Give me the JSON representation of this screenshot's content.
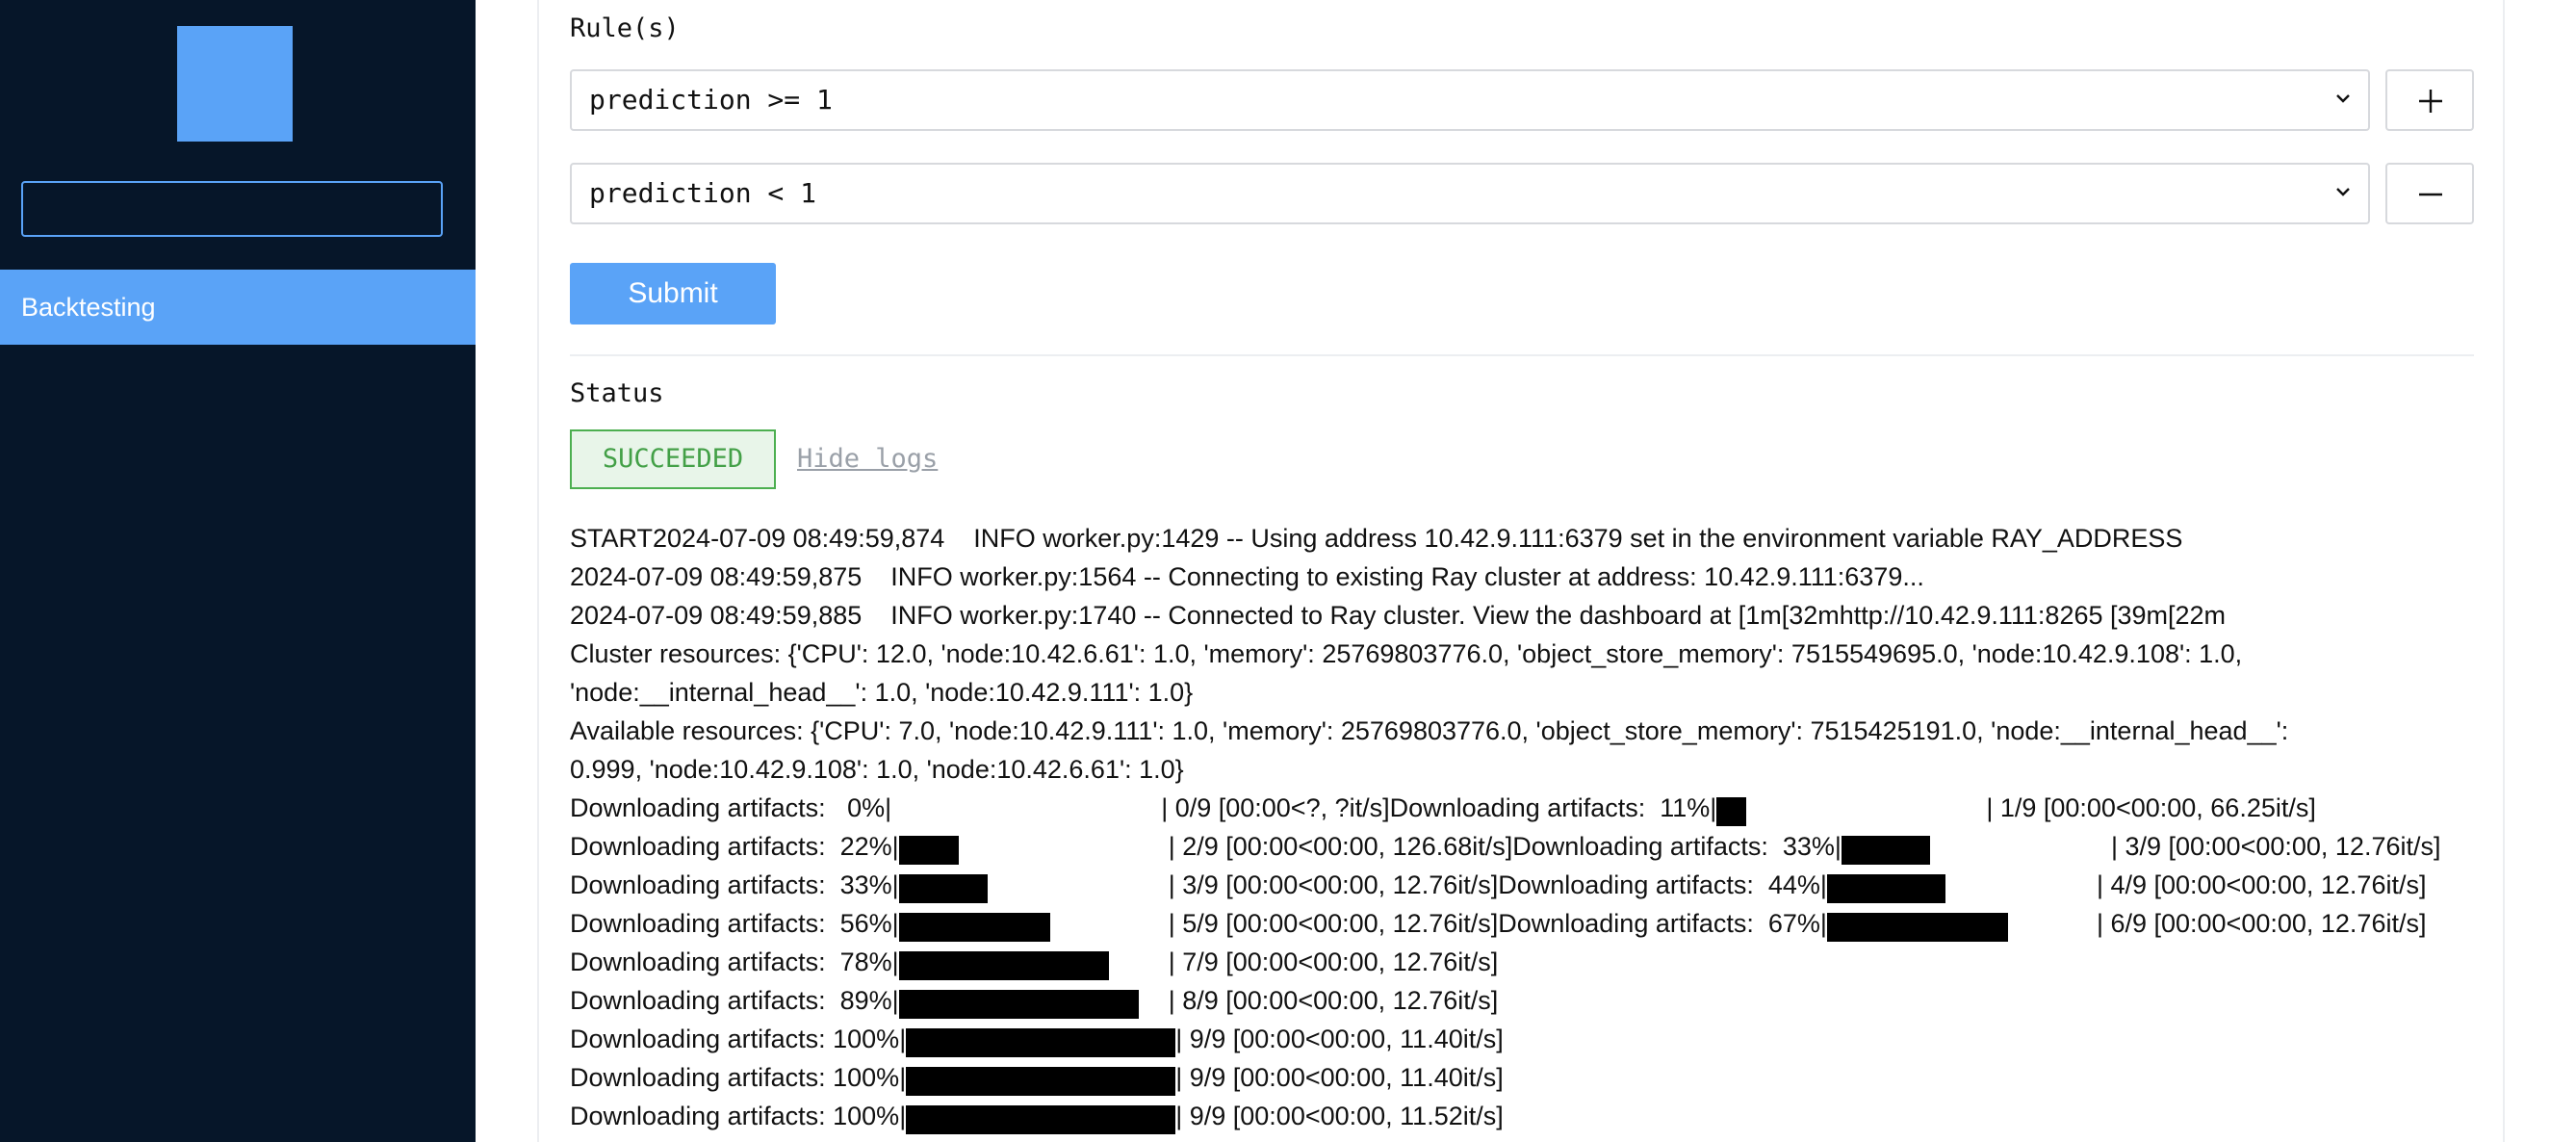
{
  "sidebar": {
    "search_value": "",
    "nav_items": [
      "Backtesting"
    ],
    "accent_color": "#5aa3f7",
    "background_color": "#061629"
  },
  "rules": {
    "label": "Rule(s)",
    "items": [
      {
        "value": "prediction >= 1",
        "action_icon": "plus-icon"
      },
      {
        "value": "prediction < 1",
        "action_icon": "minus-icon"
      }
    ]
  },
  "submit_label": "Submit",
  "status": {
    "label": "Status",
    "value": "SUCCEEDED",
    "hide_logs_label": "Hide logs"
  },
  "logs": {
    "lines": [
      "START2024-07-09 08:49:59,874    INFO worker.py:1429 -- Using address 10.42.9.111:6379 set in the environment variable RAY_ADDRESS",
      "2024-07-09 08:49:59,875    INFO worker.py:1564 -- Connecting to existing Ray cluster at address: 10.42.9.111:6379...",
      "2024-07-09 08:49:59,885    INFO worker.py:1740 -- Connected to Ray cluster. View the dashboard at [1m[32mhttp://10.42.9.111:8265 [39m[22m",
      "Cluster resources: {'CPU': 12.0, 'node:10.42.6.61': 1.0, 'memory': 25769803776.0, 'object_store_memory': 7515549695.0, 'node:10.42.9.108': 1.0,",
      "'node:__internal_head__': 1.0, 'node:10.42.9.111': 1.0}",
      "Available resources: {'CPU': 7.0, 'node:10.42.9.111': 1.0, 'memory': 25769803776.0, 'object_store_memory': 7515425191.0, 'node:__internal_head__':",
      "0.999, 'node:10.42.9.108': 1.0, 'node:10.42.6.61': 1.0}"
    ],
    "progress_lines": [
      [
        {
          "pct": "0%",
          "fill": 0.0,
          "tail": "| 0/9 [00:00<?, ?it/s]"
        },
        {
          "pct": "11%",
          "fill": 0.11,
          "tail": "| 1/9 [00:00<00:00, 66.25it/s]"
        }
      ],
      [
        {
          "pct": "22%",
          "fill": 0.22,
          "tail": "| 2/9 [00:00<00:00, 126.68it/s]"
        },
        {
          "pct": "33%",
          "fill": 0.33,
          "tail": "| 3/9 [00:00<00:00, 12.76it/s]"
        }
      ],
      [
        {
          "pct": "33%",
          "fill": 0.33,
          "tail": "| 3/9 [00:00<00:00, 12.76it/s]"
        },
        {
          "pct": "44%",
          "fill": 0.44,
          "tail": "| 4/9 [00:00<00:00, 12.76it/s]"
        }
      ],
      [
        {
          "pct": "56%",
          "fill": 0.56,
          "tail": "| 5/9 [00:00<00:00, 12.76it/s]"
        },
        {
          "pct": "67%",
          "fill": 0.67,
          "tail": "| 6/9 [00:00<00:00, 12.76it/s]"
        }
      ],
      [
        {
          "pct": "78%",
          "fill": 0.78,
          "tail": "| 7/9 [00:00<00:00, 12.76it/s]"
        }
      ],
      [
        {
          "pct": "89%",
          "fill": 0.89,
          "tail": "| 8/9 [00:00<00:00, 12.76it/s]"
        }
      ],
      [
        {
          "pct": "100%",
          "fill": 1.0,
          "tail": "| 9/9 [00:00<00:00, 11.40it/s]"
        }
      ],
      [
        {
          "pct": "100%",
          "fill": 1.0,
          "tail": "| 9/9 [00:00<00:00, 11.40it/s]"
        }
      ],
      [
        {
          "pct": "100%",
          "fill": 1.0,
          "tail": "| 9/9 [00:00<00:00, 11.52it/s]"
        }
      ]
    ],
    "progress_prefix": "Downloading artifacts:"
  }
}
